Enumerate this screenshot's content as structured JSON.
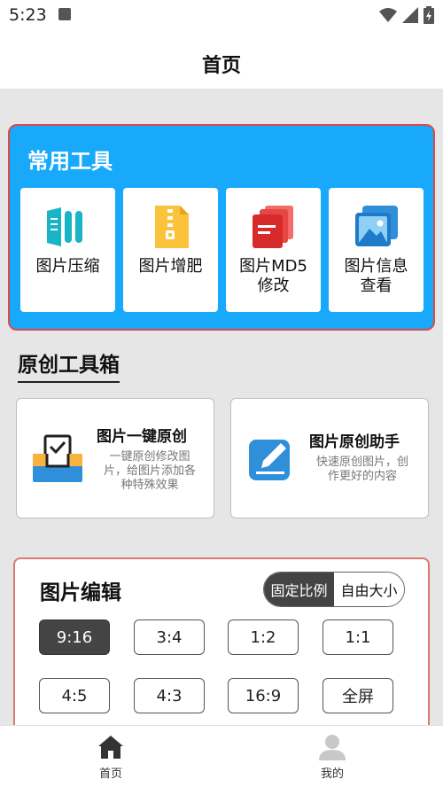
{
  "status_bar": {
    "time": "5:23"
  },
  "app_bar": {
    "title": "首页"
  },
  "common_tools": {
    "title": "常用工具",
    "items": [
      {
        "label": "图片压缩",
        "icon": "compress-icon"
      },
      {
        "label": "图片增肥",
        "icon": "zip-file-icon"
      },
      {
        "label": "图片MD5\n修改",
        "icon": "md5-files-icon"
      },
      {
        "label": "图片信息\n查看",
        "icon": "image-info-icon"
      }
    ]
  },
  "original_toolbox": {
    "title": "原创工具箱",
    "cards": [
      {
        "title": "图片一键原创",
        "desc": "一键原创修改图\n片，给图片添加各\n种特殊效果",
        "icon": "inbox-document-icon"
      },
      {
        "title": "图片原创助手",
        "desc": "快速原创图片，创\n作更好的内容",
        "icon": "pen-edit-icon"
      }
    ]
  },
  "image_edit": {
    "title": "图片编辑",
    "modes": [
      "固定比例",
      "自由大小"
    ],
    "selected_mode": "固定比例",
    "ratios": [
      "9:16",
      "3:4",
      "1:2",
      "1:1",
      "4:5",
      "4:3",
      "16:9",
      "全屏"
    ],
    "selected_ratio": "9:16"
  },
  "bottom_nav": {
    "items": [
      {
        "label": "首页",
        "icon": "home-icon",
        "active": true
      },
      {
        "label": "我的",
        "icon": "user-icon",
        "active": false
      }
    ]
  },
  "colors": {
    "accent_blue": "#18a9fb",
    "card_border_red": "#d94b4b",
    "dark_selected": "#444444"
  }
}
